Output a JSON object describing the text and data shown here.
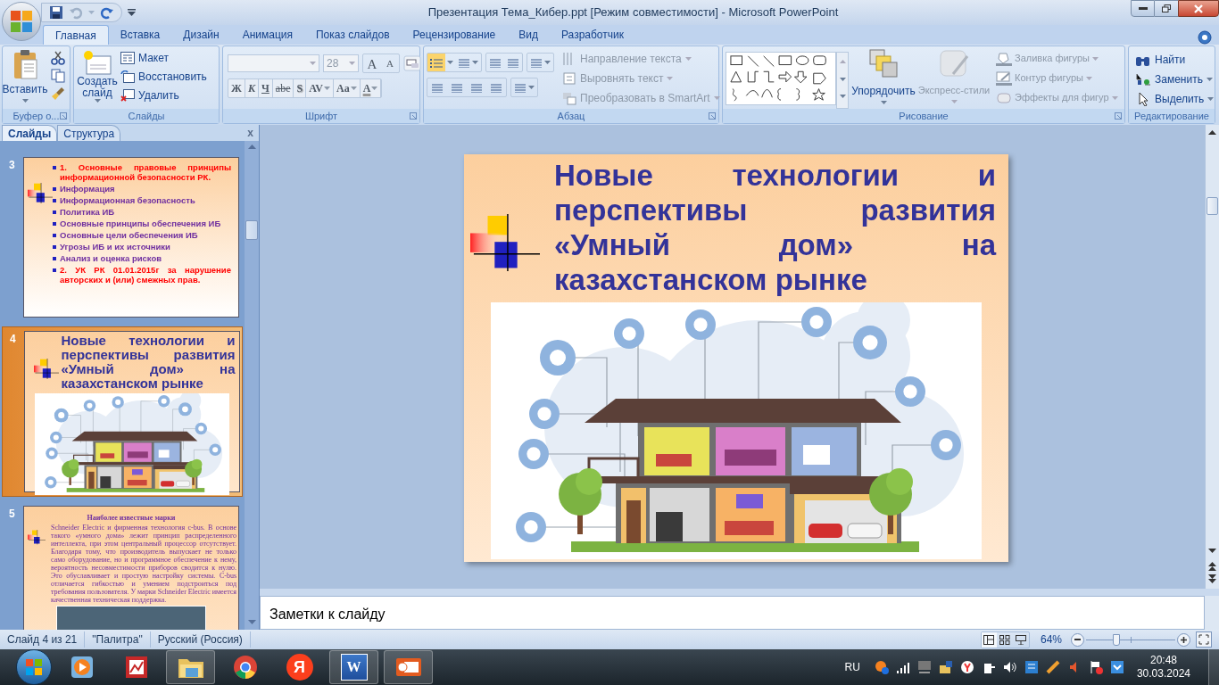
{
  "window": {
    "title": "Презентация Тема_Кибер.ppt [Режим совместимости] - Microsoft PowerPoint"
  },
  "tabs": [
    {
      "label": "Главная",
      "selected": true
    },
    {
      "label": "Вставка",
      "selected": false
    },
    {
      "label": "Дизайн",
      "selected": false
    },
    {
      "label": "Анимация",
      "selected": false
    },
    {
      "label": "Показ слайдов",
      "selected": false
    },
    {
      "label": "Рецензирование",
      "selected": false
    },
    {
      "label": "Вид",
      "selected": false
    },
    {
      "label": "Разработчик",
      "selected": false
    }
  ],
  "clipboard": {
    "label": "Буфер о...",
    "paste": "Вставить"
  },
  "slides_group": {
    "label": "Слайды",
    "new_slide": "Создать слайд",
    "layout": "Макет",
    "reset": "Восстановить",
    "delete": "Удалить"
  },
  "font": {
    "label": "Шрифт",
    "size": "28",
    "size_buttons": [
      "A",
      "A"
    ],
    "format_buttons": [
      {
        "label": "Ж",
        "kind": "bold"
      },
      {
        "label": "К",
        "kind": "italic"
      },
      {
        "label": "Ч",
        "kind": "underline"
      },
      {
        "label": "abe",
        "kind": "strike"
      },
      {
        "label": "S",
        "kind": "shadow"
      },
      {
        "label": "AV",
        "kind": "spacing"
      },
      {
        "label": "Aa",
        "kind": "case"
      },
      {
        "label": "A",
        "kind": "color"
      }
    ]
  },
  "paragraph": {
    "label": "Абзац",
    "bullets_on": true,
    "commands": [
      {
        "label": "Направление текста",
        "disabled": true
      },
      {
        "label": "Выровнять текст",
        "disabled": true
      },
      {
        "label": "Преобразовать в SmartArt",
        "disabled": true
      }
    ]
  },
  "drawing": {
    "label": "Рисование",
    "arrange": {
      "label": "Упорядочить",
      "disabled": false
    },
    "quick_styles": {
      "label": "Экспресс-стили",
      "disabled": true
    },
    "commands": [
      {
        "label": "Заливка фигуры",
        "disabled": true
      },
      {
        "label": "Контур фигуры",
        "disabled": true
      },
      {
        "label": "Эффекты для фигур",
        "disabled": true
      }
    ]
  },
  "editing": {
    "label": "Редактирование",
    "commands": [
      {
        "label": "Найти"
      },
      {
        "label": "Заменить"
      },
      {
        "label": "Выделить"
      }
    ]
  },
  "panel_tabs": [
    {
      "label": "Слайды",
      "selected": true
    },
    {
      "label": "Структура",
      "selected": false
    }
  ],
  "panel_close": "x",
  "thumbnails": [
    {
      "number": "3",
      "selected": false,
      "kind": "bullets",
      "items": [
        {
          "text": "1.  Основные правовые принципы информационной безопасности РК.",
          "color": "#ff0000"
        },
        {
          "text": "Информация",
          "color": "#7030a0"
        },
        {
          "text": "Информационная безопасность",
          "color": "#7030a0"
        },
        {
          "text": "Политика ИБ",
          "color": "#7030a0"
        },
        {
          "text": "Основные принципы обеспечения ИБ",
          "color": "#7030a0"
        },
        {
          "text": "Основные цели обеспечения  ИБ",
          "color": "#7030a0"
        },
        {
          "text": "Угрозы ИБ и их источники",
          "color": "#7030a0"
        },
        {
          "text": "Анализ и оценка рисков",
          "color": "#7030a0"
        },
        {
          "text": "2.    УК РК 01.01.2015г  за нарушение авторских и (или) смежных прав.",
          "color": "#ff0000"
        }
      ]
    },
    {
      "number": "4",
      "selected": true,
      "kind": "title_image",
      "title": "Новые технологии и перспективы развития «Умный дом» на казахстанском рынке"
    },
    {
      "number": "5",
      "selected": false,
      "kind": "text_image",
      "heading": "Наиболее известные марки",
      "body": "Schneider Electric и фирменная технология c-bus. В основе такого «умного дома» лежит принцип распределенного интеллекта, при этом центральный процессор отсутствует. Благодаря тому, что производитель выпускает не только само оборудование, но и программное обеспечение к нему, вероятность несовместимости приборов сводится к нулю. Это обуславливает и простую настройку системы. C-bus отличается гибкостью и умением подстроиться под требования пользователя. У марки Schneider Electric имеется качественная техническая поддержка."
    }
  ],
  "slide": {
    "title": "Новые технологии и перспективы развития «Умный дом» на казахстанском рынке"
  },
  "notes": {
    "placeholder": "Заметки к слайду"
  },
  "status_bar": {
    "slide": "Слайд 4 из 21",
    "theme": "\"Палитра\"",
    "language": "Русский (Россия)",
    "zoom": "64%",
    "zoom_slider": {
      "level": 0.34
    }
  },
  "taskbar": {
    "apps": [
      {
        "kind": "media",
        "running": false
      },
      {
        "kind": "picture",
        "running": false
      },
      {
        "kind": "folder",
        "running": true
      },
      {
        "kind": "chrome",
        "running": false
      },
      {
        "kind": "yandex",
        "running": false,
        "glyph": "Я"
      },
      {
        "kind": "word",
        "running": true,
        "glyph": "W"
      },
      {
        "kind": "powerpoint",
        "running": true
      }
    ],
    "language": "RU",
    "time": "20:48",
    "date": "30.03.2024"
  }
}
